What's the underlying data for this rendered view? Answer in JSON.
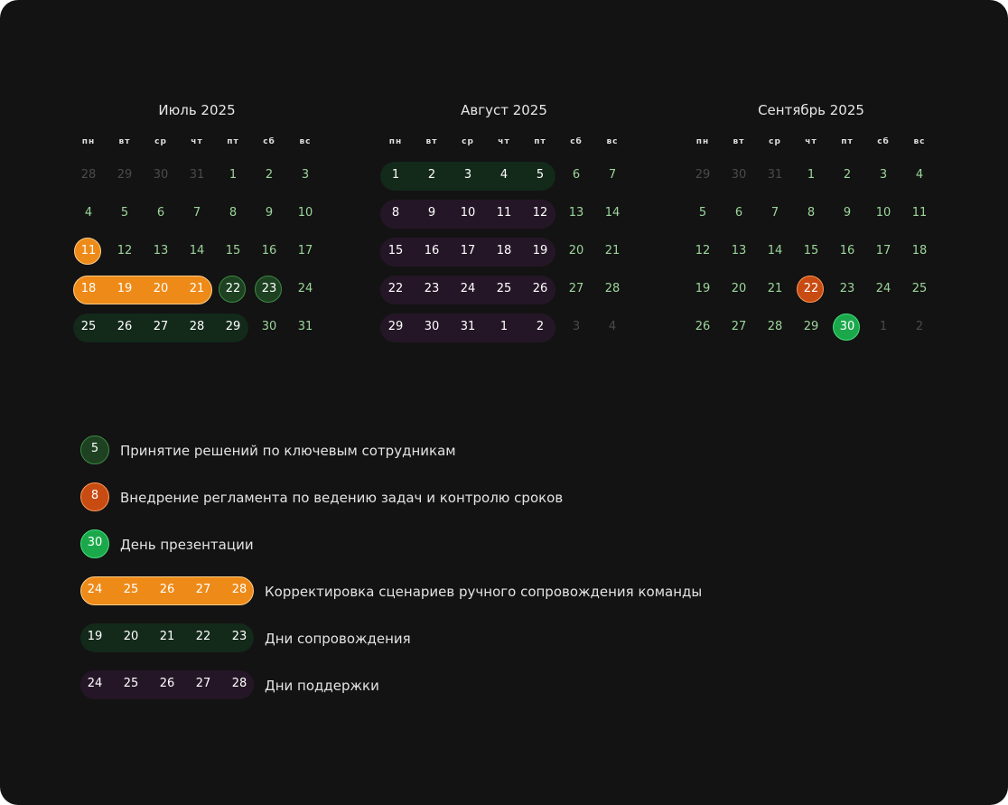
{
  "weekdays": [
    "пн",
    "вт",
    "ср",
    "чт",
    "пт",
    "сб",
    "вс"
  ],
  "colors": {
    "card_bg": "#131313",
    "day_current": "#9bd59b",
    "day_other": "#4a4a4a",
    "day_on_fill": "#ffffff",
    "key_decision_fill": "#1d4121",
    "key_decision_border": "#3e8b44",
    "regulation_fill": "#c84b12",
    "regulation_border": "#ff9a5a",
    "presentation_fill": "#1aa84b",
    "presentation_border": "#47e07b",
    "correction_fill": "#ee8a18",
    "correction_border": "#ffd08a",
    "escort_fill": "#13291a",
    "support_fill": "#251627"
  },
  "months": [
    {
      "title": "Июль 2025",
      "days": [
        "28",
        "29",
        "30",
        "31",
        "1",
        "2",
        "3",
        "4",
        "5",
        "6",
        "7",
        "8",
        "9",
        "10",
        "11",
        "12",
        "13",
        "14",
        "15",
        "16",
        "17",
        "18",
        "19",
        "20",
        "21",
        "22",
        "23",
        "24",
        "25",
        "26",
        "27",
        "28",
        "29",
        "30",
        "31"
      ],
      "other_month_days": [
        0,
        1,
        2,
        3
      ],
      "highlights": [
        {
          "type": "correction",
          "days": [
            14
          ]
        },
        {
          "type": "correction",
          "days": [
            21,
            22,
            23,
            24
          ]
        },
        {
          "type": "key_decision",
          "days": [
            25
          ]
        },
        {
          "type": "key_decision",
          "days": [
            26
          ]
        },
        {
          "type": "escort",
          "days": [
            28,
            29,
            30,
            31,
            32
          ]
        }
      ]
    },
    {
      "title": "Август 2025",
      "days": [
        "1",
        "2",
        "3",
        "4",
        "5",
        "6",
        "7",
        "8",
        "9",
        "10",
        "11",
        "12",
        "13",
        "14",
        "15",
        "16",
        "17",
        "18",
        "19",
        "20",
        "21",
        "22",
        "23",
        "24",
        "25",
        "26",
        "27",
        "28",
        "29",
        "30",
        "31",
        "1",
        "2",
        "3",
        "4"
      ],
      "other_month_days": [
        33,
        34
      ],
      "highlights": [
        {
          "type": "escort",
          "days": [
            0,
            1,
            2,
            3,
            4
          ]
        },
        {
          "type": "support",
          "days": [
            7,
            8,
            9,
            10,
            11
          ]
        },
        {
          "type": "support",
          "days": [
            14,
            15,
            16,
            17,
            18
          ]
        },
        {
          "type": "support",
          "days": [
            21,
            22,
            23,
            24,
            25
          ]
        },
        {
          "type": "support",
          "days": [
            28,
            29,
            30,
            31,
            32
          ]
        }
      ]
    },
    {
      "title": "Сентябрь 2025",
      "days": [
        "29",
        "30",
        "31",
        "1",
        "2",
        "3",
        "4",
        "5",
        "6",
        "7",
        "8",
        "9",
        "10",
        "11",
        "12",
        "13",
        "14",
        "15",
        "16",
        "17",
        "18",
        "19",
        "20",
        "21",
        "22",
        "23",
        "24",
        "25",
        "26",
        "27",
        "28",
        "29",
        "30",
        "1",
        "2"
      ],
      "other_month_days": [
        0,
        1,
        2,
        33,
        34
      ],
      "highlights": [
        {
          "type": "regulation",
          "days": [
            24
          ]
        },
        {
          "type": "presentation",
          "days": [
            32
          ]
        }
      ]
    }
  ],
  "legend": [
    {
      "type": "key_decision",
      "days": [
        "5"
      ],
      "label": "Принятие решений по ключевым сотрудникам"
    },
    {
      "type": "regulation",
      "days": [
        "8"
      ],
      "label": "Внедрение регламента по ведению задач и контролю сроков"
    },
    {
      "type": "presentation",
      "days": [
        "30"
      ],
      "label": "День презентации"
    },
    {
      "type": "correction",
      "days": [
        "24",
        "25",
        "26",
        "27",
        "28"
      ],
      "label": "Корректировка сценариев ручного сопровождения команды"
    },
    {
      "type": "escort",
      "days": [
        "19",
        "20",
        "21",
        "22",
        "23"
      ],
      "label": "Дни сопровождения"
    },
    {
      "type": "support",
      "days": [
        "24",
        "25",
        "26",
        "27",
        "28"
      ],
      "label": "Дни поддержки"
    }
  ]
}
